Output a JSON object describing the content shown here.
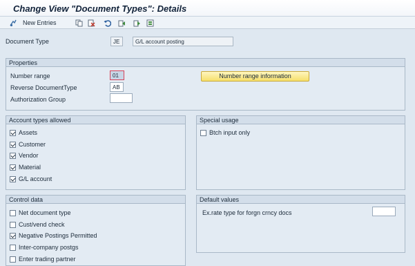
{
  "window": {
    "title": "Change View \"Document Types\": Details"
  },
  "toolbar": {
    "new_entries_label": "New Entries",
    "icons": [
      "new-entries-icon",
      "copy-icon",
      "delete-icon",
      "undo-icon",
      "previous-entry-icon",
      "next-entry-icon",
      "select-all-icon"
    ]
  },
  "header": {
    "document_type_label": "Document Type",
    "document_type_value": "JE",
    "document_type_desc": "G/L account posting"
  },
  "properties": {
    "title": "Properties",
    "number_range_label": "Number range",
    "number_range_value": "01",
    "reverse_doc_type_label": "Reverse DocumentType",
    "reverse_doc_type_value": "AB",
    "authorization_group_label": "Authorization Group",
    "authorization_group_value": "",
    "number_range_info_button": "Number range information"
  },
  "account_types": {
    "title": "Account types allowed",
    "items": [
      {
        "label": "Assets",
        "checked": true
      },
      {
        "label": "Customer",
        "checked": true
      },
      {
        "label": "Vendor",
        "checked": true
      },
      {
        "label": "Material",
        "checked": true
      },
      {
        "label": "G/L account",
        "checked": true
      }
    ]
  },
  "special_usage": {
    "title": "Special usage",
    "items": [
      {
        "label": "Btch input only",
        "checked": false
      }
    ]
  },
  "control_data": {
    "title": "Control data",
    "items": [
      {
        "label": "Net document type",
        "checked": false
      },
      {
        "label": "Cust/vend check",
        "checked": false
      },
      {
        "label": "Negative Postings Permitted",
        "checked": true
      },
      {
        "label": "Inter-company postgs",
        "checked": false
      },
      {
        "label": "Enter trading partner",
        "checked": false
      }
    ]
  },
  "default_values": {
    "title": "Default values",
    "ex_rate_label": "Ex.rate type for forgn crncy docs",
    "ex_rate_value": ""
  }
}
